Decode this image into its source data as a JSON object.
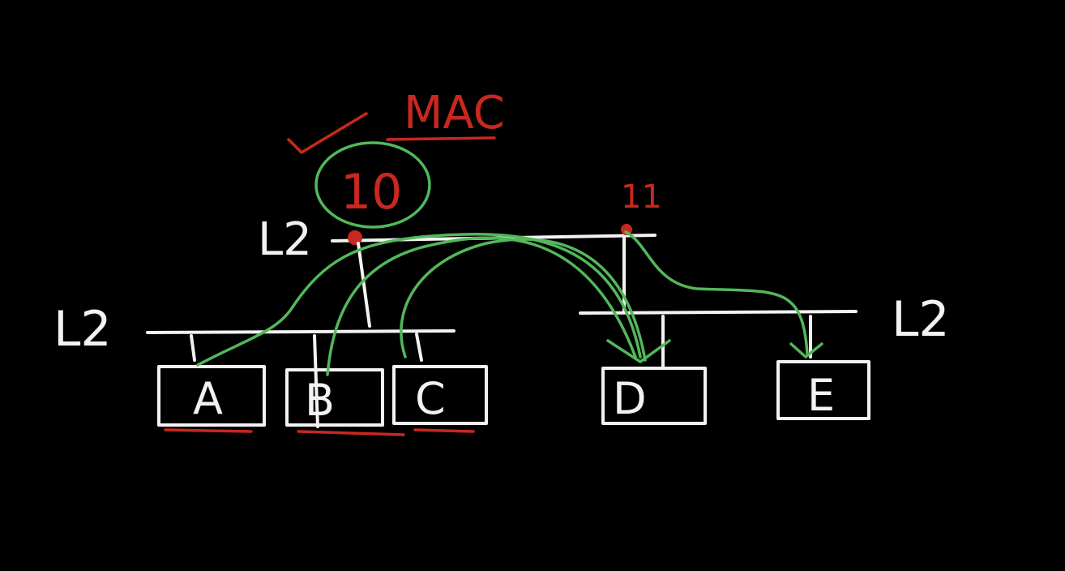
{
  "colors": {
    "background": "#000000",
    "chalk": "#f2f2f2",
    "annotation_red": "#c8281e",
    "path_green": "#52b85a"
  },
  "labels": {
    "mac": "MAC",
    "switch_left_top": "10",
    "switch_right_top": "11",
    "layer_top": "L2",
    "layer_left": "L2",
    "layer_right": "L2"
  },
  "hosts": [
    {
      "id": "a",
      "label": "A",
      "underlined": true
    },
    {
      "id": "b",
      "label": "B",
      "underlined": true
    },
    {
      "id": "c",
      "label": "C",
      "underlined": true
    },
    {
      "id": "d",
      "label": "D",
      "underlined": false
    },
    {
      "id": "e",
      "label": "E",
      "underlined": false
    }
  ]
}
